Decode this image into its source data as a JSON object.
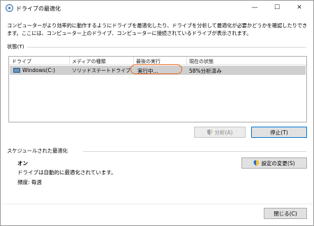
{
  "window": {
    "title": "ドライブの最適化",
    "minimize_glyph": "—",
    "maximize_glyph": "☐",
    "close_glyph": "✕"
  },
  "description": "コンピューターがより効率的に動作するようにドライブを最適化したり、ドライブを分析して最適化が必要かどうかを確認したりできます。ここには、コンピューター上のドライブ、コンピューターに接続されているドライブが表示されます。",
  "status_section": {
    "label": "状態(T)",
    "columns": [
      "ドライブ",
      "メディアの種類",
      "最後の実行",
      "現在の状態"
    ],
    "rows": [
      {
        "drive": "Windows(C:)",
        "media_type": "ソリッドステートドライブ",
        "last_run": "実行中...",
        "current_status": "58%分析済み"
      }
    ],
    "highlight_color": "#e8681f"
  },
  "buttons": {
    "analyze": "分析(A)",
    "stop": "停止(T)",
    "change_settings": "設定の変更(S)",
    "close": "閉じる(C)"
  },
  "schedule_section": {
    "label": "スケジュールされた最適化",
    "state": "オン",
    "detail": "ドライブは自動的に最適化されています。",
    "frequency": "頻度: 毎週"
  }
}
